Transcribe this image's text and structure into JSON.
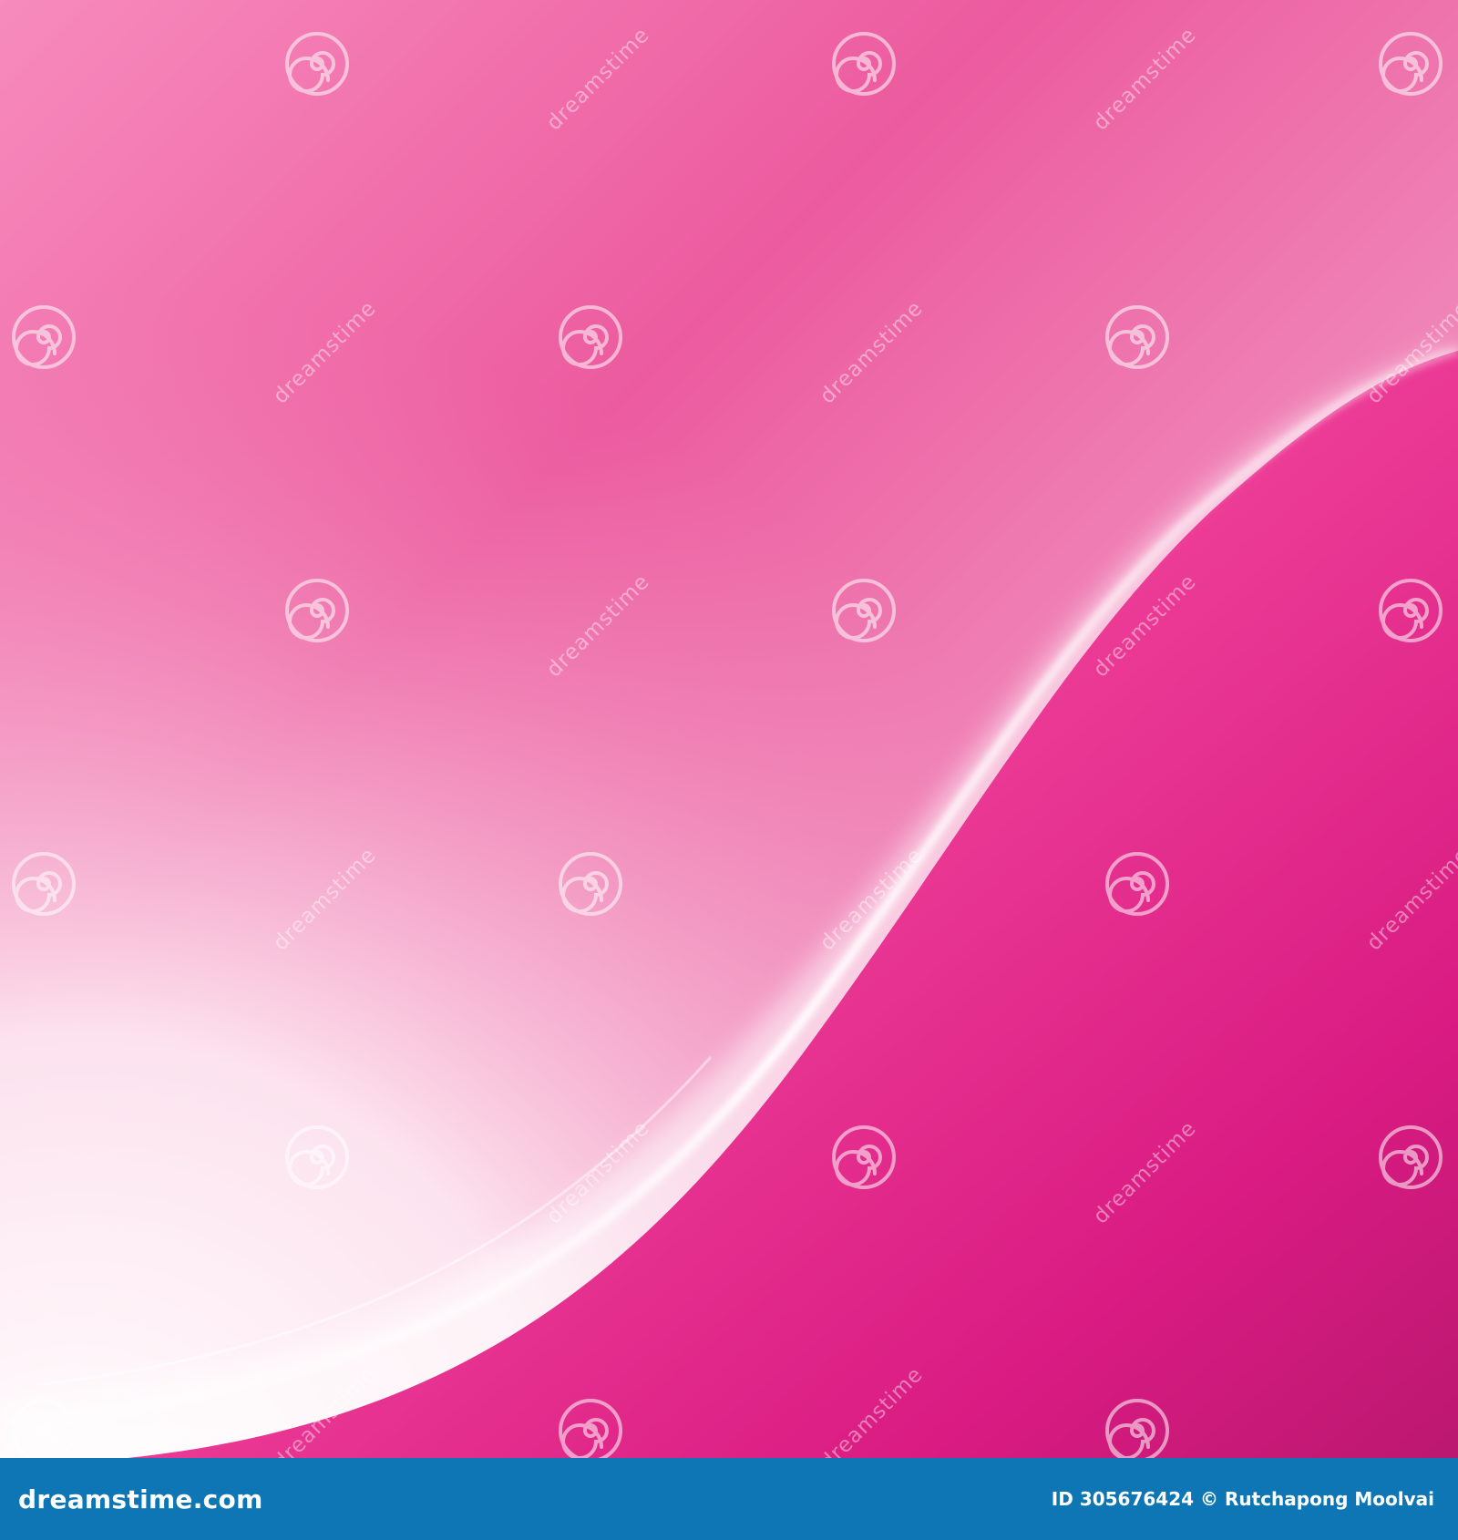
{
  "image": {
    "subject": "abstract pink gradient background",
    "colors": {
      "primary_pink": "#e84f95",
      "deep_magenta": "#d91b82",
      "highlight_white": "#ffffff",
      "footer_blue": "#0f76b5"
    }
  },
  "watermark": {
    "text": "dreamstime",
    "icon": "spiral-icon"
  },
  "footer": {
    "brand": "dreamstime.com",
    "id_label": "ID",
    "id_value": "305676424",
    "copyright_symbol": "©",
    "author": "Rutchapong Moolvai"
  }
}
